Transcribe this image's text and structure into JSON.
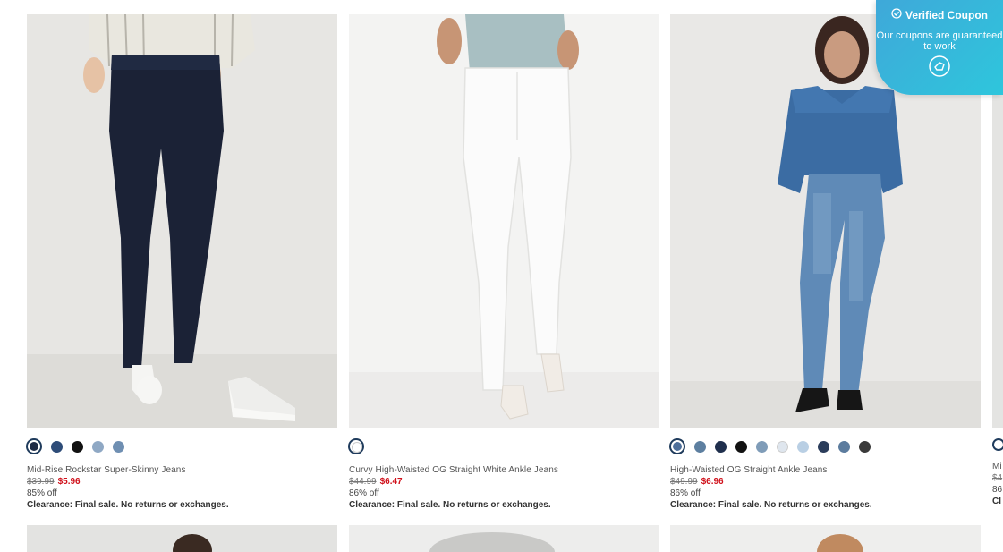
{
  "coupon": {
    "title": "Verified Coupon",
    "subtitle": "Our coupons are guaranteed to work"
  },
  "products": [
    {
      "name": "Mid-Rise Rockstar Super-Skinny Jeans",
      "old_price": "$39.99",
      "sale_price": "$5.96",
      "discount": "85% off",
      "note": "Clearance: Final sale. No returns or exchanges.",
      "swatches": [
        "#1d2a44",
        "#2e4c78",
        "#111111",
        "#8fa8c4",
        "#6f8fb2"
      ],
      "selected": 0
    },
    {
      "name": "Curvy High-Waisted OG Straight White Ankle Jeans",
      "old_price": "$44.99",
      "sale_price": "$6.47",
      "discount": "86% off",
      "note": "Clearance: Final sale. No returns or exchanges.",
      "swatches": [
        "#ffffff"
      ],
      "selected": 0
    },
    {
      "name": "High-Waisted OG Straight Ankle Jeans",
      "old_price": "$49.99",
      "sale_price": "$6.96",
      "discount": "86% off",
      "note": "Clearance: Final sale. No returns or exchanges.",
      "swatches": [
        "#4e6f9a",
        "#5d7fa0",
        "#1f2f4d",
        "#111111",
        "#7f9cb8",
        "#dfe6ee",
        "#b9cfe4",
        "#2b3d5b",
        "#5c7c9e",
        "#3a3a3a"
      ],
      "selected": 0
    }
  ],
  "partial_card": {
    "name_fragment": "Mi",
    "old_fragment": "$4",
    "discount_fragment": "86",
    "note_fragment": "Cl"
  }
}
